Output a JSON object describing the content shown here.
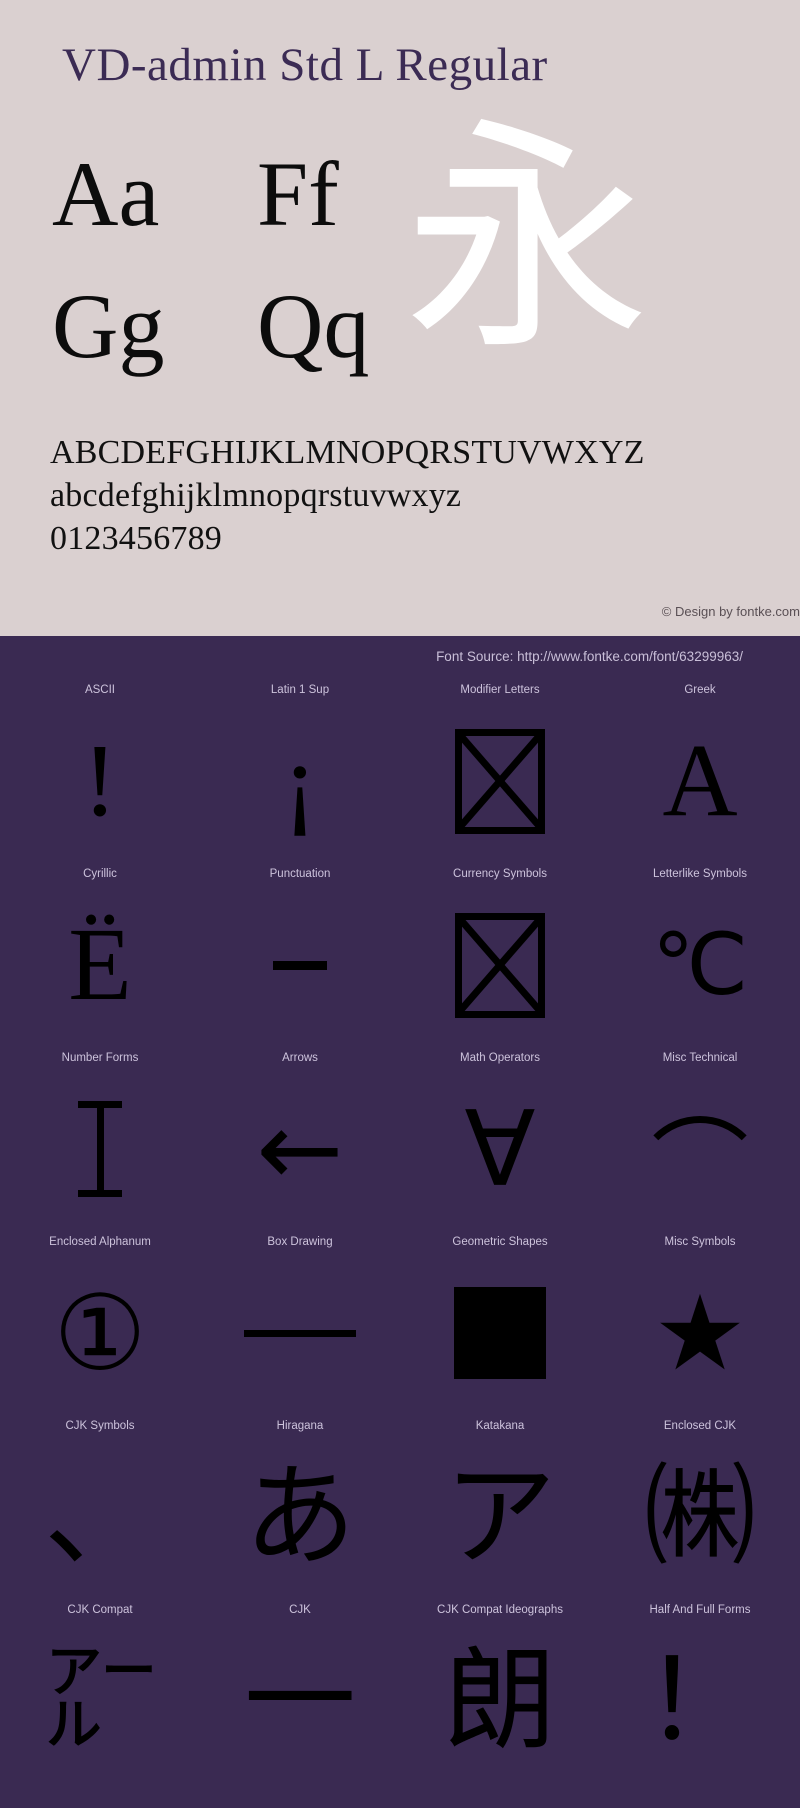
{
  "meta": {
    "colors": {
      "hero_bg": "#dad0d0",
      "panel_bg": "#3a2a52",
      "title": "#3b2b54",
      "glyph_dark": "#0c0c0c",
      "glyph_white": "#ffffff",
      "label": "#cdc3dc"
    }
  },
  "hero": {
    "title": "VD-admin Std L Regular",
    "glyph_pairs": [
      "Aa",
      "Ff",
      "Gg",
      "Qq"
    ],
    "cjk_sample": "永",
    "alphabet_upper": "ABCDEFGHIJKLMNOPQRSTUVWXYZ",
    "alphabet_lower": "abcdefghijklmnopqrstuvwxyz",
    "digits": "0123456789",
    "copyright": "© Design by fontke.com"
  },
  "panel": {
    "font_source": "Font Source: http://www.fontke.com/font/63299963/",
    "blocks": [
      {
        "label": "ASCII",
        "glyph": "!",
        "style": "serif"
      },
      {
        "label": "Latin 1 Sup",
        "glyph": "¡",
        "style": "serif"
      },
      {
        "label": "Modifier Letters",
        "glyph": "",
        "style": "tofu"
      },
      {
        "label": "Greek",
        "glyph": "Α",
        "style": "serif"
      },
      {
        "label": "Cyrillic",
        "glyph": "Ё",
        "style": "serif"
      },
      {
        "label": "Punctuation",
        "glyph": "–",
        "style": "hyphen"
      },
      {
        "label": "Currency Symbols",
        "glyph": "",
        "style": "tofu"
      },
      {
        "label": "Letterlike Symbols",
        "glyph": "℃",
        "style": "serif-small"
      },
      {
        "label": "Number Forms",
        "glyph": "Ⅰ",
        "style": "bar"
      },
      {
        "label": "Arrows",
        "glyph": "←",
        "style": "sans"
      },
      {
        "label": "Math Operators",
        "glyph": "∀",
        "style": "sans"
      },
      {
        "label": "Misc Technical",
        "glyph": "⏜",
        "style": "arc"
      },
      {
        "label": "Enclosed Alphanum",
        "glyph": "①",
        "style": "sans"
      },
      {
        "label": "Box Drawing",
        "glyph": "─",
        "style": "line"
      },
      {
        "label": "Geometric Shapes",
        "glyph": "■",
        "style": "square"
      },
      {
        "label": "Misc Symbols",
        "glyph": "★",
        "style": "sans"
      },
      {
        "label": "CJK Symbols",
        "glyph": "、",
        "style": "cjk"
      },
      {
        "label": "Hiragana",
        "glyph": "あ",
        "style": "cjk"
      },
      {
        "label": "Katakana",
        "glyph": "ア",
        "style": "cjk"
      },
      {
        "label": "Enclosed CJK",
        "glyph": "㈱",
        "style": "cjk"
      },
      {
        "label": "CJK Compat",
        "glyph": "㌃",
        "style": "cjk"
      },
      {
        "label": "CJK",
        "glyph": "一",
        "style": "cjk"
      },
      {
        "label": "CJK Compat Ideographs",
        "glyph": "朗",
        "style": "cjk"
      },
      {
        "label": "Half And Full Forms",
        "glyph": "！",
        "style": "cjk"
      }
    ]
  }
}
